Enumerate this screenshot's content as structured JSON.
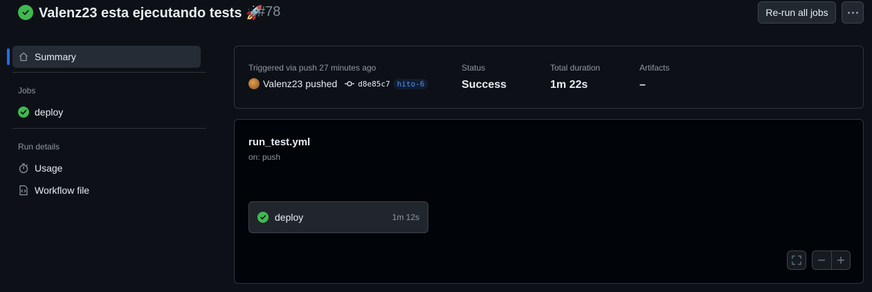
{
  "header": {
    "title": "Valenz23 esta ejecutando tests 🚀",
    "run_number": "#78",
    "rerun_label": "Re-run all jobs",
    "more_icon": "kebab-horizontal-icon",
    "status_icon": "check-circle-fill-icon"
  },
  "sidebar": {
    "summary_label": "Summary",
    "jobs_heading": "Jobs",
    "jobs": [
      {
        "label": "deploy",
        "status": "success"
      }
    ],
    "run_details_heading": "Run details",
    "usage_label": "Usage",
    "workflow_file_label": "Workflow file"
  },
  "summary": {
    "triggered_text": "Triggered via push 27 minutes ago",
    "actor": "Valenz23",
    "action": "pushed",
    "commit_sha": "d8e85c7",
    "branch": "hito-6",
    "status_label": "Status",
    "status_value": "Success",
    "duration_label": "Total duration",
    "duration_value": "1m 22s",
    "artifacts_label": "Artifacts",
    "artifacts_value": "–"
  },
  "graph": {
    "workflow_name": "run_test.yml",
    "trigger_text": "on: push",
    "job_name": "deploy",
    "job_duration": "1m 12s"
  },
  "colors": {
    "success": "#3fb950",
    "accent": "#1f6feb",
    "background": "#0d1117"
  }
}
